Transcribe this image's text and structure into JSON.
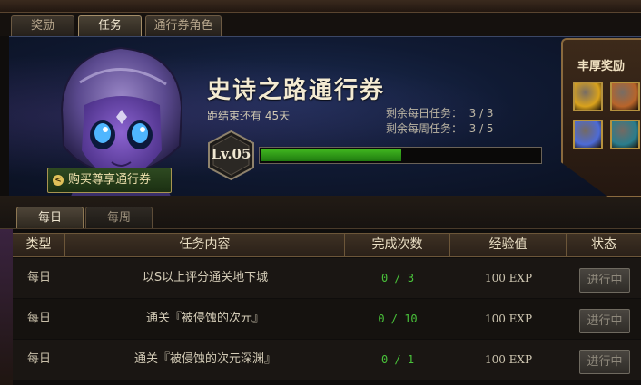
{
  "main_tabs": [
    {
      "label": "奖励",
      "active": false
    },
    {
      "label": "任务",
      "active": true
    },
    {
      "label": "通行券角色",
      "active": false
    }
  ],
  "banner": {
    "title": "史诗之路通行券",
    "remaining": "距结束还有 45天",
    "daily_quota": "剩余每日任务：  3 / 3",
    "weekly_quota": "剩余每周任务：  3 / 5",
    "level": "Lv.05",
    "xp_fraction": 0.5,
    "buy_button": "购买尊享通行券"
  },
  "rewards": {
    "title": "丰厚奖励",
    "items": [
      {
        "icon": "gold-chest-icon",
        "color": "#d9a21c"
      },
      {
        "icon": "treasure-box-icon",
        "color": "#b8642a"
      },
      {
        "icon": "plus-ten-card-icon",
        "color": "#4d6bd6"
      },
      {
        "icon": "blue-gem-icon",
        "color": "#2a7d8c"
      }
    ]
  },
  "sub_tabs": [
    {
      "label": "每日",
      "active": true
    },
    {
      "label": "每周",
      "active": false
    }
  ],
  "table": {
    "headers": [
      "类型",
      "任务内容",
      "完成次数",
      "经验值",
      "状态"
    ],
    "rows": [
      {
        "type": "每日",
        "desc": "以S以上评分通关地下城",
        "count": "0 / 3",
        "exp": "100 EXP",
        "status": "进行中"
      },
      {
        "type": "每日",
        "desc": "通关『被侵蚀的次元』",
        "count": "0 / 10",
        "exp": "100 EXP",
        "status": "进行中"
      },
      {
        "type": "每日",
        "desc": "通关『被侵蚀的次元深渊』",
        "count": "0 / 1",
        "exp": "100 EXP",
        "status": "进行中"
      }
    ]
  }
}
